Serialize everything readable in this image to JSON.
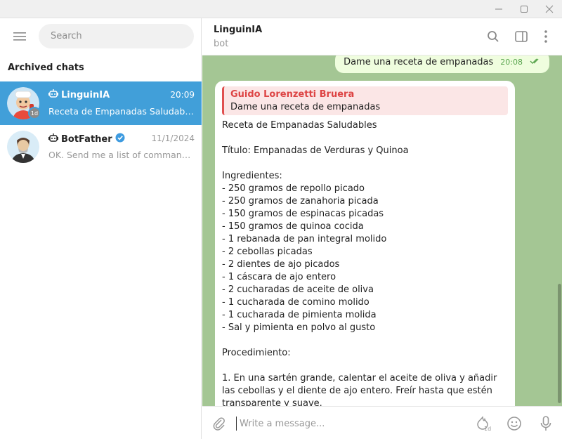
{
  "left": {
    "search_placeholder": "Search",
    "section_title": "Archived chats",
    "chats": [
      {
        "name": "LinguinIA",
        "time": "20:09",
        "preview": "Receta de Empanadas Saludables...",
        "badge": "1d",
        "active": true
      },
      {
        "name": "BotFather",
        "time": "11/1/2024",
        "preview": "OK. Send me a list of commands f...",
        "verified": true,
        "active": false
      }
    ]
  },
  "header": {
    "title": "LinguinIA",
    "subtitle": "bot"
  },
  "messages": {
    "outgoing": {
      "text": "Dame una receta de empanadas",
      "time": "20:08"
    },
    "incoming": {
      "reply_name": "Guido Lorenzetti Bruera",
      "reply_text": "Dame una receta de empanadas",
      "text": "Receta de Empanadas Saludables\n\nTítulo: Empanadas de Verduras y Quinoa\n\nIngredientes:\n- 250 gramos de repollo picado\n- 250 gramos de zanahoria picada\n- 150 gramos de espinacas picadas\n- 150 gramos de quinoa cocida\n- 1 rebanada de pan integral molido\n- 2 cebollas picadas\n- 2 dientes de ajo picados\n- 1 cáscara de ajo entero\n- 2 cucharadas de aceite de oliva\n- 1 cucharada de comino molido\n- 1 cucharada de pimienta molida\n- Sal y pimienta en polvo al gusto\n\nProcedimiento:\n\n1. En una sartén grande, calentar el aceite de oliva y añadir las cebollas y el diente de ajo entero. Freír hasta que estén transparente y suave."
    }
  },
  "composer": {
    "placeholder": "Write a message...",
    "timer_label": "1d"
  },
  "colors": {
    "accent": "#419fd9",
    "chat_bg": "#a4c694",
    "outgoing_bubble": "#effdde",
    "reply_accent": "#e05050"
  },
  "icons": [
    "menu-icon",
    "bot-icon",
    "verified-icon",
    "search-icon",
    "sidebar-panel-icon",
    "more-vertical-icon",
    "double-check-icon",
    "attach-icon",
    "timer-icon",
    "emoji-icon",
    "microphone-icon",
    "minimize-icon",
    "maximize-icon",
    "close-icon"
  ]
}
